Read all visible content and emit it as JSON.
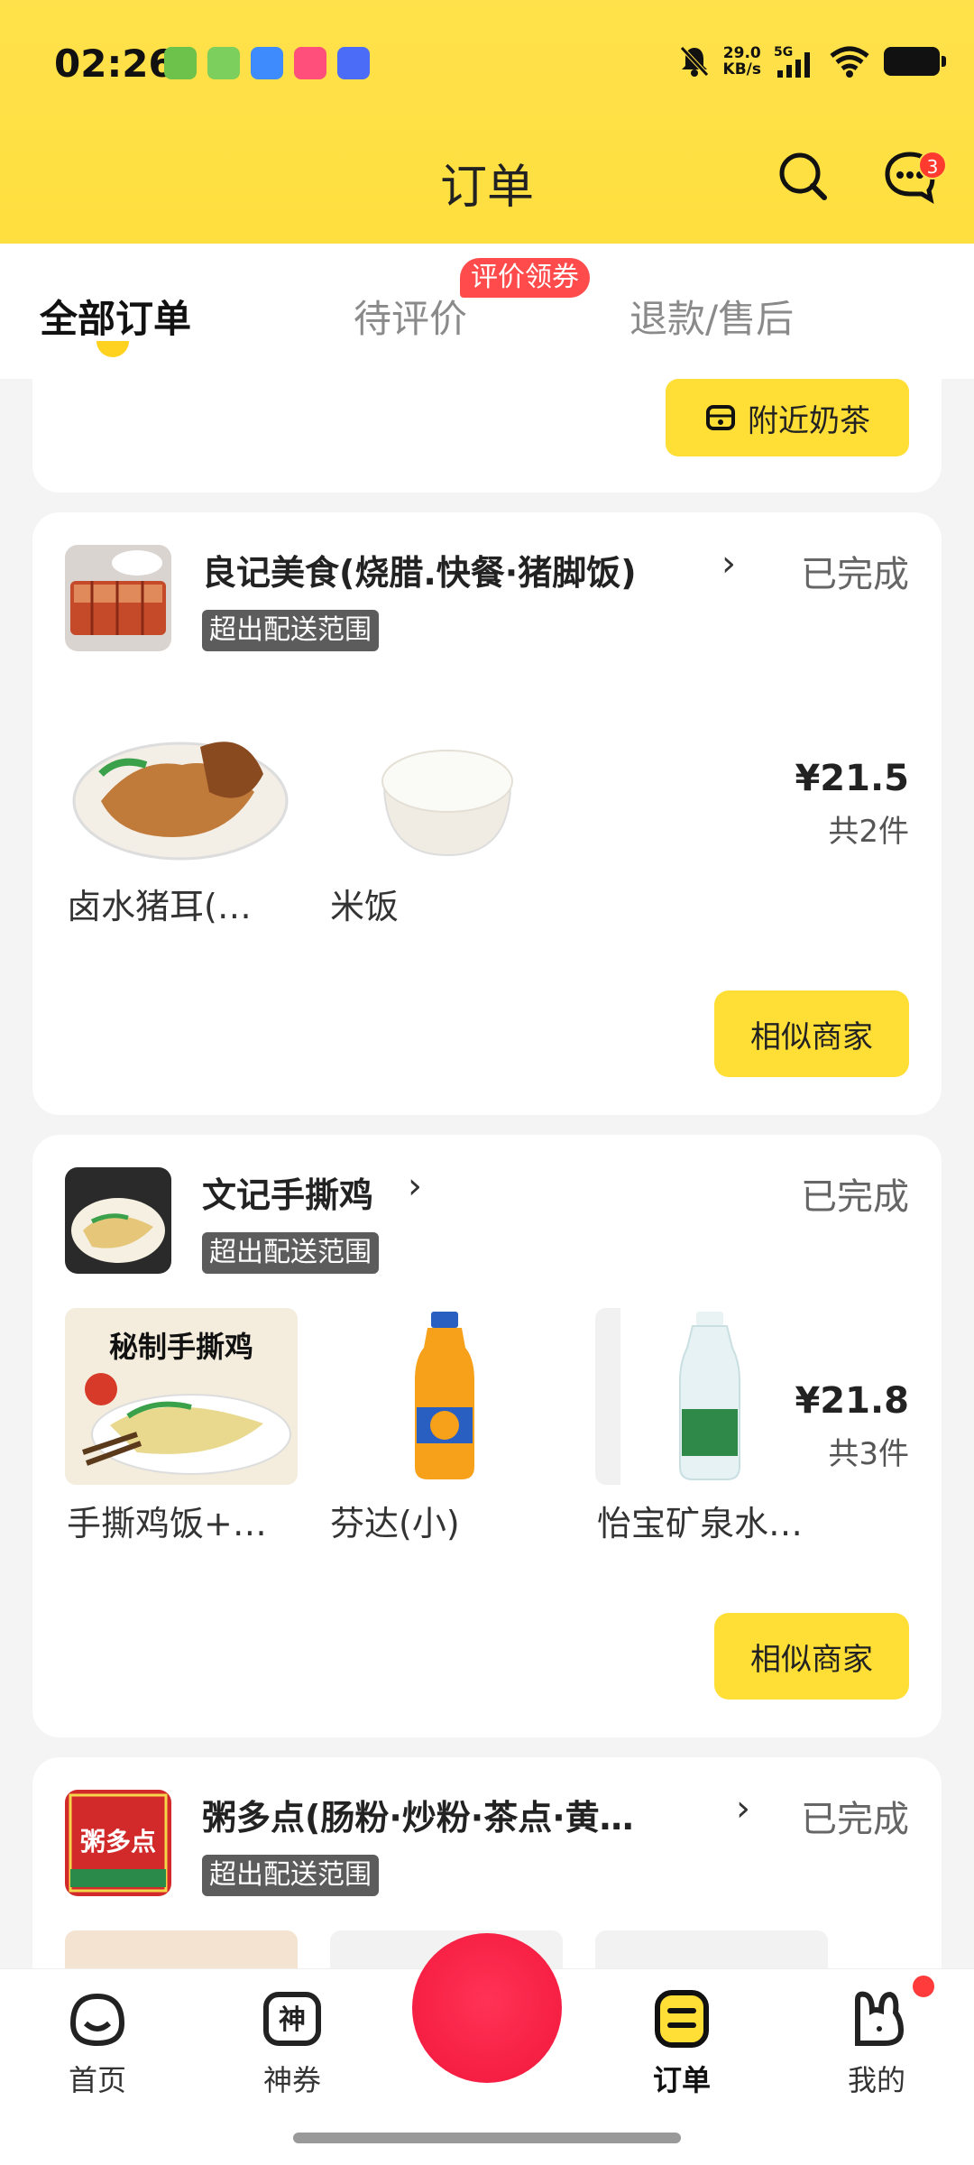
{
  "statusbar": {
    "time": "02:26",
    "net_speed_value": "29.0",
    "net_speed_unit": "KB/s",
    "network": "5G"
  },
  "header": {
    "title": "订单",
    "msg_badge": "3"
  },
  "tabs": [
    {
      "label": "全部订单",
      "active": true
    },
    {
      "label": "待评价",
      "badge": "评价领券"
    },
    {
      "label": "退款/售后"
    }
  ],
  "partial_card": {
    "nearby_button": "附近奶茶"
  },
  "orders": [
    {
      "shop": "良记美食(烧腊.快餐·猪脚饭)",
      "status": "已完成",
      "tag": "超出配送范围",
      "items": [
        "卤水猪耳(…",
        "米饭"
      ],
      "price": "¥21.5",
      "count": "共2件",
      "button": "相似商家"
    },
    {
      "shop": "文记手撕鸡",
      "status": "已完成",
      "tag": "超出配送范围",
      "items": [
        "手撕鸡饭+…",
        "芬达(小)",
        "怡宝矿泉水…"
      ],
      "item_image_text": "秘制手撕鸡",
      "price": "¥21.8",
      "count": "共3件",
      "button": "相似商家"
    },
    {
      "shop": "粥多点(肠粉·炒粉·茶点·黄…",
      "status": "已完成",
      "tag": "超出配送范围",
      "shop_logo_text": "粥多点"
    }
  ],
  "bottom_nav": [
    {
      "label": "首页"
    },
    {
      "label": "神券"
    },
    {
      "label": "订单",
      "active": true
    },
    {
      "label": "我的"
    }
  ],
  "colors": {
    "brand_yellow": "#ffde36",
    "badge_red": "#ff4b4b",
    "center_red": "#f2163c"
  }
}
